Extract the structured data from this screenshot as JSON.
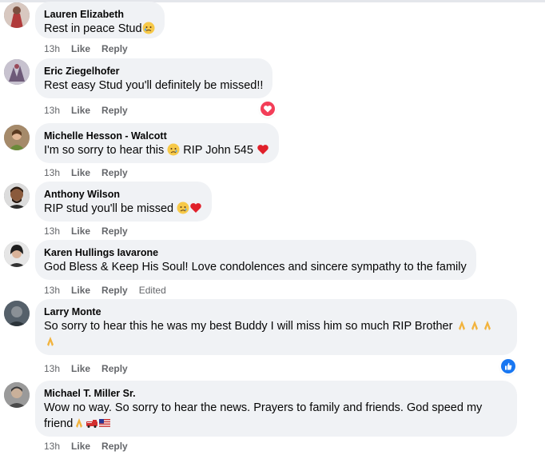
{
  "comments": [
    {
      "name": "Lauren Elizabeth",
      "text": "Rest in peace Stud",
      "emojis": [
        "crying-face"
      ],
      "time": "13h",
      "like": "Like",
      "reply": "Reply",
      "avatar_color": "#b03a3a"
    },
    {
      "name": "Eric Ziegelhofer",
      "text": "Rest easy Stud you'll definitely be missed!!",
      "time": "13h",
      "like": "Like",
      "reply": "Reply",
      "reaction": "love",
      "avatar_color": "#6d5a78"
    },
    {
      "name": "Michelle Hesson - Walcott",
      "text": "I'm so sorry to hear this",
      "text2": "RIP John 545",
      "time": "13h",
      "like": "Like",
      "reply": "Reply",
      "avatar_color": "#8b6b4a"
    },
    {
      "name": "Anthony Wilson",
      "text": "RIP stud you'll be missed",
      "time": "13h",
      "like": "Like",
      "reply": "Reply",
      "avatar_color": "#6b4c3b"
    },
    {
      "name": "Karen Hullings Iavarone",
      "text": "God Bless & Keep His Soul! Love condolences and sincere sympathy to the family",
      "time": "13h",
      "like": "Like",
      "reply": "Reply",
      "edited": "Edited",
      "avatar_color": "#4a4a4a"
    },
    {
      "name": "Larry Monte",
      "text": "So sorry to hear this he was my best Buddy I will miss him so much RIP Brother",
      "time": "13h",
      "like": "Like",
      "reply": "Reply",
      "reaction": "like",
      "avatar_color": "#3f4a55"
    },
    {
      "name": "Michael T. Miller Sr.",
      "text": "Wow no way. So sorry to hear the news. Prayers to family and friends. God speed my",
      "text2": "friend",
      "time": "13h",
      "like": "Like",
      "reply": "Reply",
      "avatar_color": "#5a5a5a"
    }
  ],
  "colors": {
    "bubble": "#f0f2f5",
    "meta": "#65676b",
    "love": "#f33e58",
    "like": "#1877f2"
  }
}
